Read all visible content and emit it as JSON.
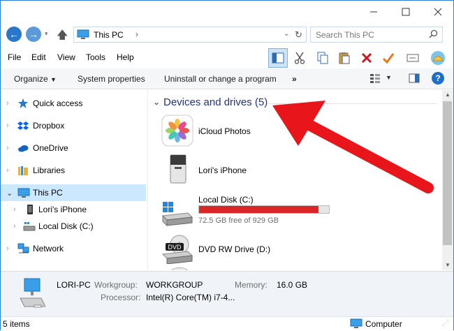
{
  "titlebar": {
    "min_icon": "minimize-icon",
    "max_icon": "maximize-icon",
    "close_icon": "close-icon"
  },
  "address": {
    "path": "This PC",
    "search_placeholder": "Search This PC"
  },
  "menu": [
    "File",
    "Edit",
    "View",
    "Tools",
    "Help"
  ],
  "commands": {
    "organize": "Organize",
    "system_properties": "System properties",
    "uninstall": "Uninstall or change a program",
    "more": "»"
  },
  "sidebar": {
    "items": [
      {
        "label": "Quick access",
        "icon": "star-icon"
      },
      {
        "label": "Dropbox",
        "icon": "dropbox-icon"
      },
      {
        "label": "OneDrive",
        "icon": "onedrive-icon"
      },
      {
        "label": "Libraries",
        "icon": "libraries-icon"
      },
      {
        "label": "This PC",
        "icon": "computer-icon"
      },
      {
        "label": "Lori's iPhone",
        "icon": "phone-icon"
      },
      {
        "label": "Local Disk (C:)",
        "icon": "drive-icon"
      },
      {
        "label": "Network",
        "icon": "network-icon"
      }
    ]
  },
  "content": {
    "group_title": "Devices and drives (5)",
    "devices": [
      {
        "name": "iCloud Photos",
        "icon": "icloud-photos-icon"
      },
      {
        "name": "Lori's iPhone",
        "icon": "iphone-device-icon"
      },
      {
        "name": "Local Disk (C:)",
        "icon": "windows-drive-icon",
        "free_text": "72.5 GB free of 929 GB",
        "used_fraction": 0.922
      },
      {
        "name": "DVD RW Drive (D:)",
        "icon": "dvd-drive-icon"
      }
    ],
    "arrow_color": "#e8151b"
  },
  "details": {
    "pc_name": "LORI-PC",
    "workgroup_label": "Workgroup:",
    "workgroup_value": "WORKGROUP",
    "memory_label": "Memory:",
    "memory_value": "16.0 GB",
    "processor_label": "Processor:",
    "processor_value": "Intel(R) Core(TM) i7-4..."
  },
  "status": {
    "items": "5 items",
    "zone": "Computer"
  }
}
